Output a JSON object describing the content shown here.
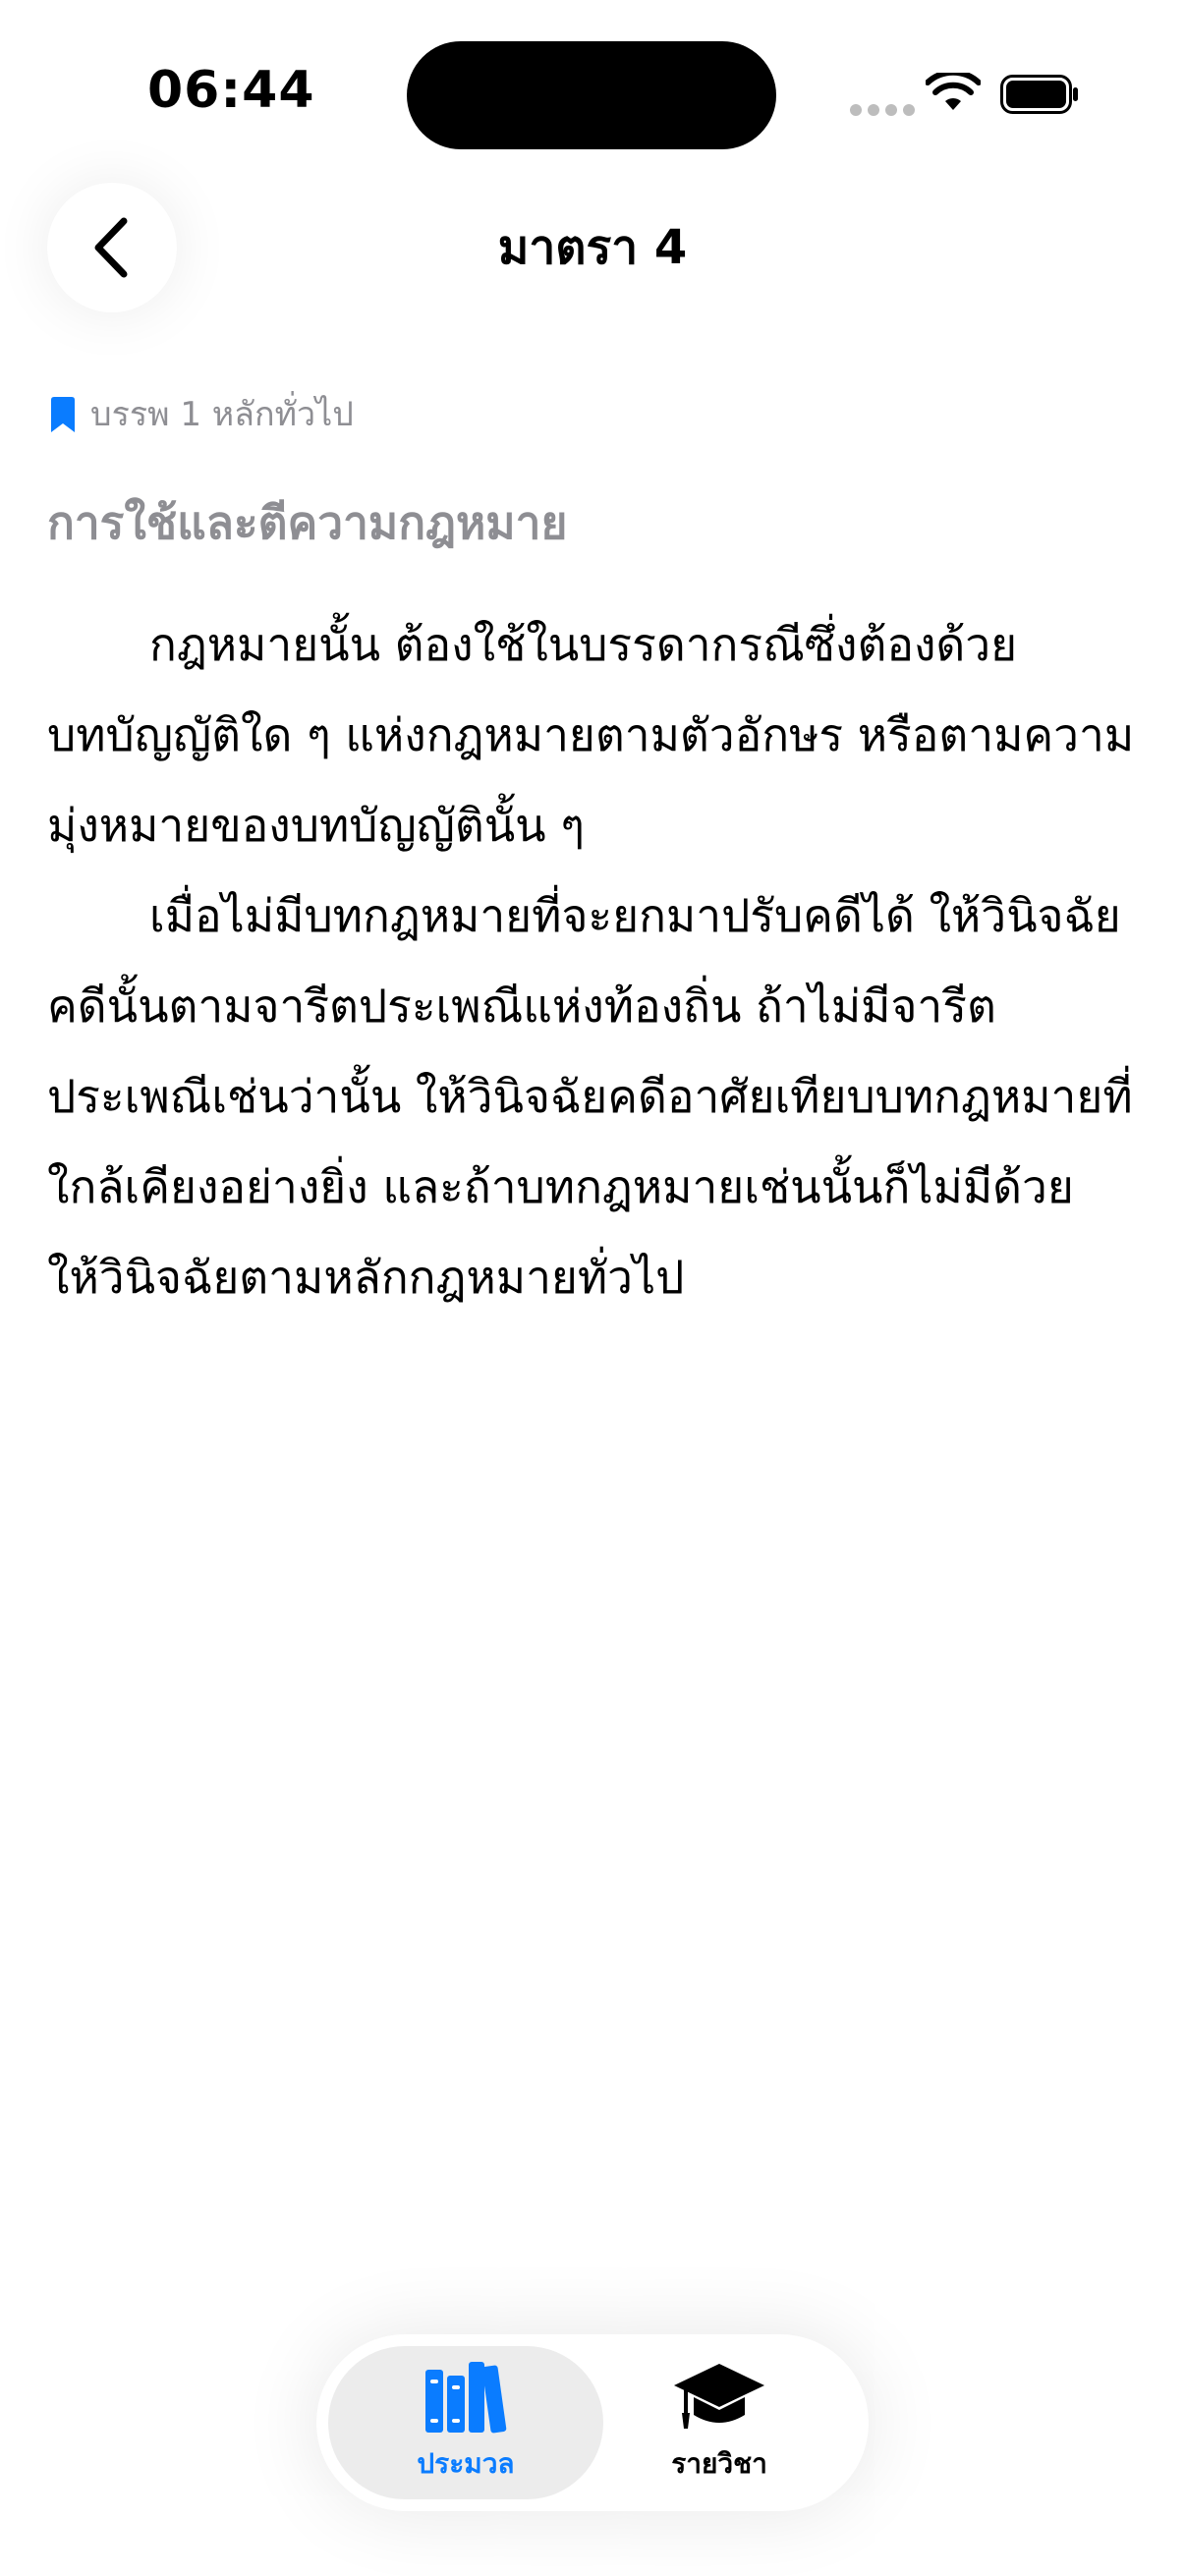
{
  "status_bar": {
    "time": "06:44"
  },
  "nav": {
    "title": "มาตรา 4",
    "back_icon": "chevron-left-icon"
  },
  "breadcrumb": {
    "icon": "bookmark-icon",
    "text": "บรรพ 1 หลักทั่วไป"
  },
  "section": {
    "heading": "การใช้และตีความกฎหมาย"
  },
  "article": {
    "paragraphs": [
      "กฎหมายนั้น ต้องใช้ในบรรดากรณีซึ่งต้องด้วยบทบัญญัติใด ๆ แห่งกฎหมายตามตัวอักษร หรือตามความมุ่งหมายของบทบัญญัตินั้น ๆ",
      "เมื่อไม่มีบทกฎหมายที่จะยกมาปรับคดีได้ ให้วินิจฉัยคดีนั้นตามจารีตประเพณีแห่งท้องถิ่น ถ้าไม่มีจารีตประเพณีเช่นว่านั้น ให้วินิจฉัยคดีอาศัยเทียบบทกฎหมายที่ใกล้เคียงอย่างยิ่ง และถ้าบทกฎหมายเช่นนั้นก็ไม่มีด้วย ให้วินิจฉัยตามหลักกฎหมายทั่วไป"
    ]
  },
  "tab_bar": {
    "tabs": [
      {
        "label": "ประมวล",
        "icon": "books-icon",
        "active": true
      },
      {
        "label": "รายวิชา",
        "icon": "graduation-cap-icon",
        "active": false
      }
    ]
  },
  "colors": {
    "accent": "#0a7cff",
    "secondary_text": "#8e8e93"
  }
}
